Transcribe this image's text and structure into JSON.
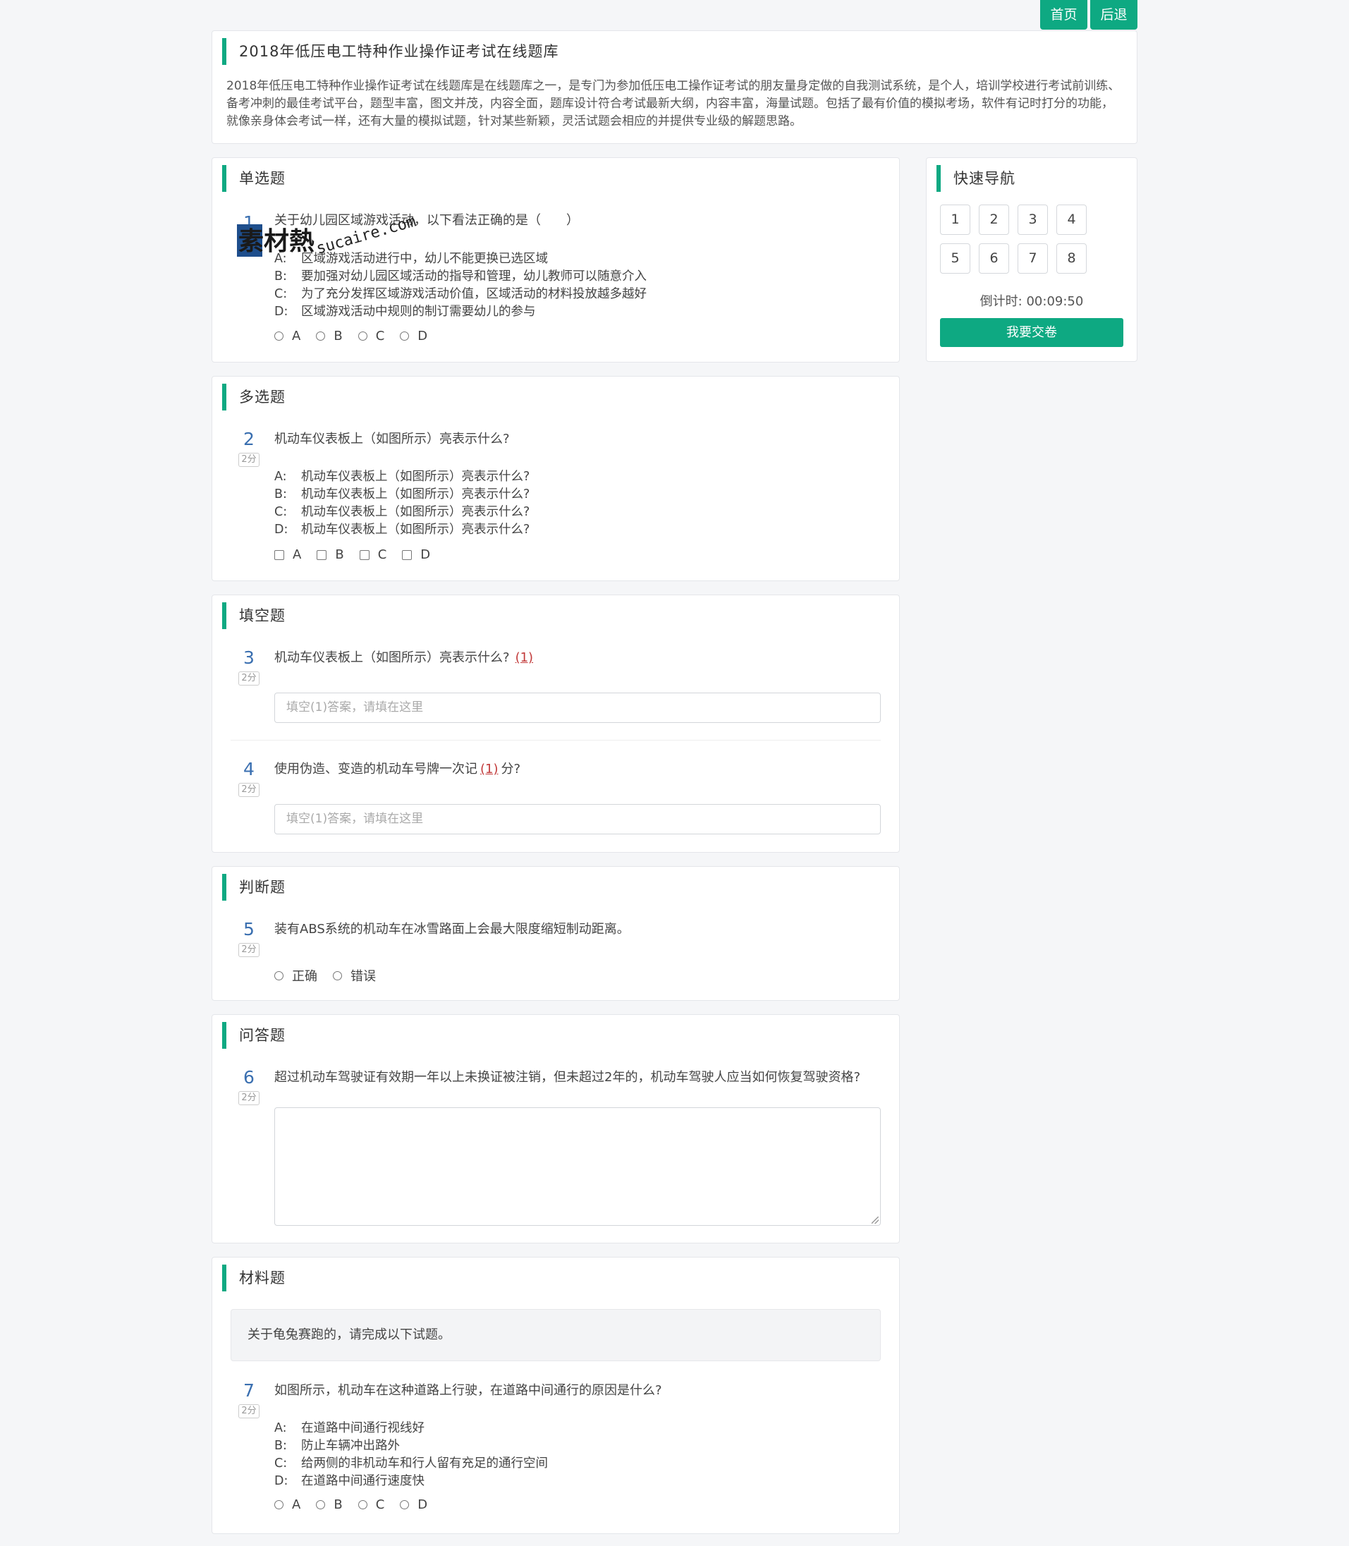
{
  "topbar": {
    "home": "首页",
    "back": "后退"
  },
  "intro": {
    "title": "2018年低压电工特种作业操作证考试在线题库",
    "text": "2018年低压电工特种作业操作证考试在线题库是在线题库之一，是专门为参加低压电工操作证考试的朋友量身定做的自我测试系统，是个人，培训学校进行考试前训练、备考冲刺的最佳考试平台，题型丰富，图文并茂，内容全面，题库设计符合考试最新大纲，内容丰富，海量试题。包括了最有价值的模拟考场，软件有记时打分的功能，就像亲身体会考试一样，还有大量的模拟试题，针对某些新颖，灵活试题会相应的并提供专业级的解题思路。"
  },
  "watermark": {
    "brand": "素材熱",
    "site": "sucaire.com"
  },
  "single": {
    "title": "单选题",
    "num": "1",
    "question": "关于幼儿园区域游戏活动，以下看法正确的是（　　）",
    "options": [
      {
        "k": "A:",
        "t": "区域游戏活动进行中，幼儿不能更换已选区域"
      },
      {
        "k": "B:",
        "t": "要加强对幼儿园区域活动的指导和管理，幼儿教师可以随意介入"
      },
      {
        "k": "C:",
        "t": "为了充分发挥区域游戏活动价值，区域活动的材料投放越多越好"
      },
      {
        "k": "D:",
        "t": "区域游戏活动中规则的制订需要幼儿的参与"
      }
    ],
    "choices": [
      "A",
      "B",
      "C",
      "D"
    ]
  },
  "multi": {
    "title": "多选题",
    "num": "2",
    "score": "2分",
    "question": "机动车仪表板上（如图所示）亮表示什么?",
    "options": [
      {
        "k": "A:",
        "t": "机动车仪表板上（如图所示）亮表示什么?"
      },
      {
        "k": "B:",
        "t": "机动车仪表板上（如图所示）亮表示什么?"
      },
      {
        "k": "C:",
        "t": "机动车仪表板上（如图所示）亮表示什么?"
      },
      {
        "k": "D:",
        "t": "机动车仪表板上（如图所示）亮表示什么?"
      }
    ],
    "choices": [
      "A",
      "B",
      "C",
      "D"
    ]
  },
  "fill": {
    "title": "填空题",
    "q3": {
      "num": "3",
      "score": "2分",
      "text": "机动车仪表板上（如图所示）亮表示什么?",
      "blank": "(1)",
      "placeholder": "填空(1)答案，请填在这里"
    },
    "q4": {
      "num": "4",
      "score": "2分",
      "text_pre": "使用伪造、变造的机动车号牌一次记",
      "blank": "(1)",
      "text_post": "分?",
      "placeholder": "填空(1)答案，请填在这里"
    }
  },
  "judge": {
    "title": "判断题",
    "num": "5",
    "score": "2分",
    "question": "装有ABS系统的机动车在冰雪路面上会最大限度缩短制动距离。",
    "true_label": "正确",
    "false_label": "错误"
  },
  "qa": {
    "title": "问答题",
    "num": "6",
    "score": "2分",
    "question": "超过机动车驾驶证有效期一年以上未换证被注销，但未超过2年的，机动车驾驶人应当如何恢复驾驶资格?"
  },
  "material": {
    "title": "材料题",
    "passage": "关于龟兔赛跑的，请完成以下试题。",
    "num": "7",
    "score": "2分",
    "question": "如图所示，机动车在这种道路上行驶，在道路中间通行的原因是什么?",
    "options": [
      {
        "k": "A:",
        "t": "在道路中间通行视线好"
      },
      {
        "k": "B:",
        "t": "防止车辆冲出路外"
      },
      {
        "k": "C:",
        "t": "给两侧的非机动车和行人留有充足的通行空间"
      },
      {
        "k": "D:",
        "t": "在道路中间通行速度快"
      }
    ],
    "choices": [
      "A",
      "B",
      "C",
      "D"
    ]
  },
  "nav": {
    "title": "快速导航",
    "items": [
      "1",
      "2",
      "3",
      "4",
      "5",
      "6",
      "7",
      "8"
    ],
    "timer_label": "倒计时:",
    "timer_value": "00:09:50",
    "submit": "我要交卷"
  },
  "colors": {
    "accent": "#0ea982",
    "number": "#3a6fb0",
    "blank": "#c23b3b"
  }
}
